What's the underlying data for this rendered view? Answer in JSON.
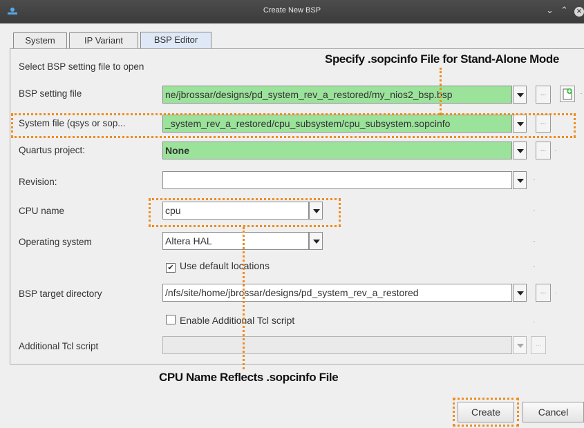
{
  "window": {
    "title": "Create New BSP"
  },
  "tabs": [
    "System",
    "IP Variant",
    "BSP Editor"
  ],
  "form": {
    "intro": "Select BSP setting file to open",
    "bsp_setting_label": "BSP setting file",
    "bsp_setting_value": "ne/jbrossar/designs/pd_system_rev_a_restored/my_nios2_bsp.bsp",
    "system_file_label": "System file (qsys or sop...",
    "system_file_value": "_system_rev_a_restored/cpu_subsystem/cpu_subsystem.sopcinfo",
    "quartus_label": "Quartus project:",
    "quartus_value": "None",
    "revision_label": "Revision:",
    "revision_value": "",
    "cpu_label": "CPU name",
    "cpu_value": "cpu",
    "os_label": "Operating system",
    "os_value": "Altera HAL",
    "use_default_label": "Use default locations",
    "use_default_checked": true,
    "target_label": "BSP target directory",
    "target_value": "/nfs/site/home/jbrossar/designs/pd_system_rev_a_restored",
    "enable_tcl_label": "Enable Additional Tcl script",
    "enable_tcl_checked": false,
    "tcl_label": "Additional Tcl script",
    "tcl_value": "",
    "browse_label": "..."
  },
  "buttons": {
    "create": "Create",
    "cancel": "Cancel"
  },
  "annotations": {
    "top": "Specify .sopcinfo File for Stand-Alone  Mode",
    "bottom": "CPU Name Reflects .sopcinfo File"
  },
  "colors": {
    "highlight": "#f08c1e",
    "field_green": "#9be29b"
  }
}
